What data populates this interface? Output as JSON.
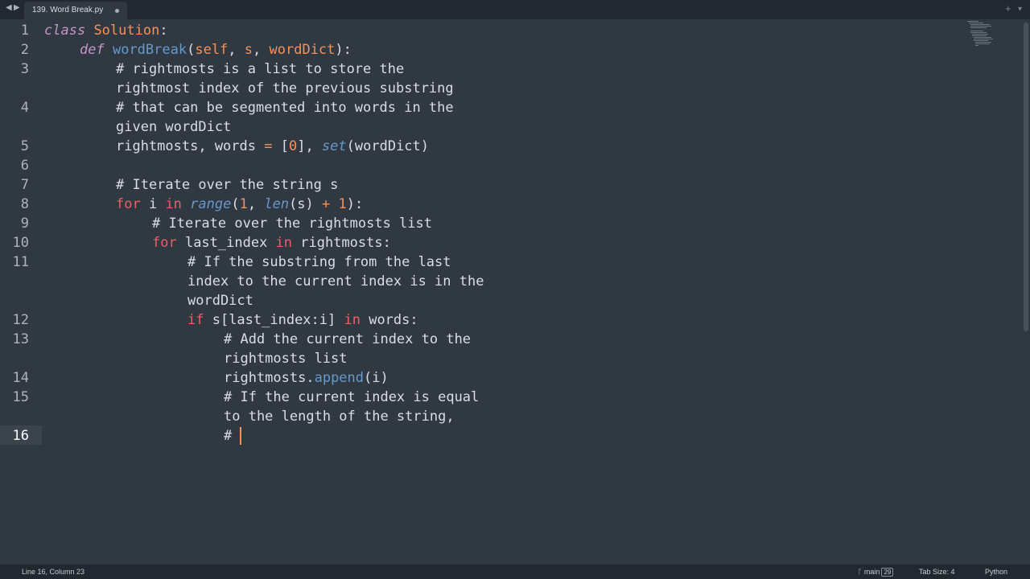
{
  "tabbar": {
    "nav_left": "◀",
    "nav_right": "▶",
    "tab_title": "139. Word Break.py",
    "new_tab": "+",
    "overflow": "▾"
  },
  "editor": {
    "line_numbers": [
      "1",
      "2",
      "3",
      "4",
      "5",
      "6",
      "7",
      "8",
      "9",
      "10",
      "11",
      "12",
      "13",
      "14",
      "15",
      "16"
    ],
    "active_line": "16",
    "code": {
      "l1_class": "class",
      "l1_name": "Solution",
      "l1_colon": ":",
      "l2_def": "def",
      "l2_fn": "wordBreak",
      "l2_open": "(",
      "l2_self": "self",
      "l2_sep1": ", ",
      "l2_s": "s",
      "l2_sep2": ", ",
      "l2_wd": "wordDict",
      "l2_close": "):",
      "l3a": "# rightmosts is a list to store the",
      "l3b": "rightmost index of the previous substring",
      "l4a": "# that can be segmented into words in the",
      "l4b": "given wordDict",
      "l5_a": "rightmosts, words ",
      "l5_eq": "=",
      "l5_b": " [",
      "l5_num": "0",
      "l5_c": "], ",
      "l5_set": "set",
      "l5_d": "(wordDict)",
      "l7": "# Iterate over the string s",
      "l8_for": "for",
      "l8_a": " i ",
      "l8_in": "in",
      "l8_sp": " ",
      "l8_range": "range",
      "l8_b": "(",
      "l8_one": "1",
      "l8_c": ", ",
      "l8_len": "len",
      "l8_d": "(s) ",
      "l8_plus": "+",
      "l8_sp2": " ",
      "l8_one2": "1",
      "l8_e": "):",
      "l9": "# Iterate over the rightmosts list",
      "l10_for": "for",
      "l10_a": " last_index ",
      "l10_in": "in",
      "l10_b": " rightmosts:",
      "l11a": "# If the substring from the last",
      "l11b": "index to the current index is in the",
      "l11c": "wordDict",
      "l12_if": "if",
      "l12_a": " s[last_index:i] ",
      "l12_in": "in",
      "l12_b": " words:",
      "l13a": "# Add the current index to the",
      "l13b": "rightmosts list",
      "l14_a": "rightmosts.",
      "l14_fn": "append",
      "l14_b": "(i)",
      "l15a": "# If the current index is equal",
      "l15b": "to the length of the string,",
      "l16": "# "
    }
  },
  "statusbar": {
    "position": "Line 16, Column 23",
    "branch_icon": "ᚴ",
    "branch": "main",
    "branch_count": "29",
    "tab_size": "Tab Size: 4",
    "syntax": "Python"
  }
}
